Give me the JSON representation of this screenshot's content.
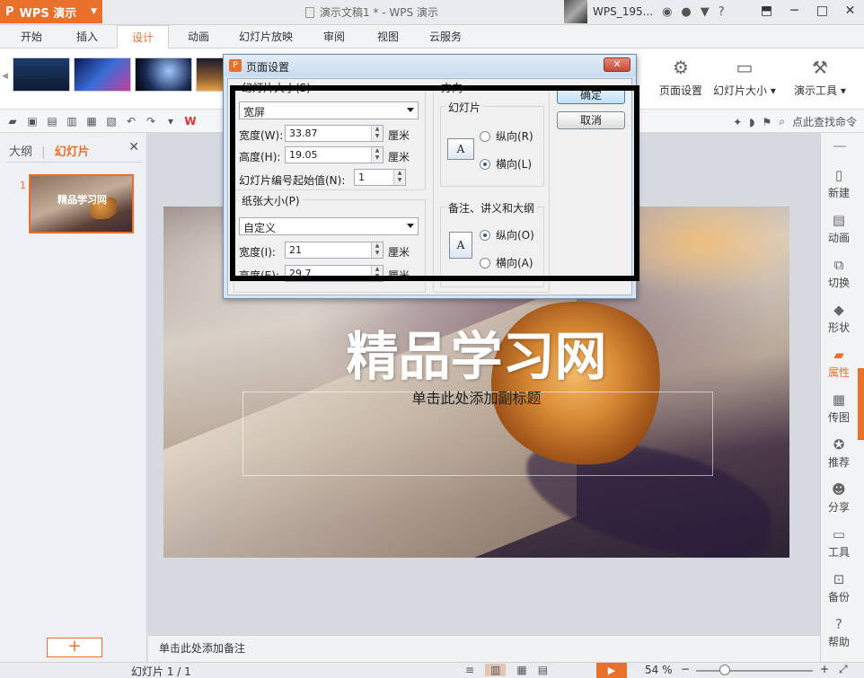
{
  "app": {
    "name": "WPS 演示",
    "logo": "P",
    "doc_title": "演示文稿1 * - WPS 演示",
    "user_name": "WPS_195..."
  },
  "tabs": [
    {
      "label": "开始"
    },
    {
      "label": "插入"
    },
    {
      "label": "设计"
    },
    {
      "label": "动画"
    },
    {
      "label": "幻灯片放映"
    },
    {
      "label": "审阅"
    },
    {
      "label": "视图"
    },
    {
      "label": "云服务"
    }
  ],
  "ribbon": {
    "page_setup": "页面设置",
    "slide_size": "幻灯片大小",
    "presenter_tools": "演示工具"
  },
  "quick_access": {
    "find_command": "点此查找命令"
  },
  "left_panel": {
    "outline_tab": "大纲",
    "slides_tab": "幻灯片",
    "separator": "|",
    "slide_number": "1",
    "thumb_title": "精品学习网",
    "add_slide": "+"
  },
  "slide": {
    "title": "精品学习网",
    "subtitle_placeholder": "单击此处添加副标题"
  },
  "notes_placeholder": "单击此处添加备注",
  "right_toolbar": [
    {
      "label": "新建",
      "icon": "new-file-icon"
    },
    {
      "label": "动画",
      "icon": "animation-icon"
    },
    {
      "label": "切换",
      "icon": "transition-icon"
    },
    {
      "label": "形状",
      "icon": "shape-icon"
    },
    {
      "label": "属性",
      "icon": "properties-icon"
    },
    {
      "label": "传图",
      "icon": "upload-image-icon"
    },
    {
      "label": "推荐",
      "icon": "recommend-icon"
    },
    {
      "label": "分享",
      "icon": "share-icon"
    },
    {
      "label": "工具",
      "icon": "toolbox-icon"
    },
    {
      "label": "备份",
      "icon": "backup-icon"
    },
    {
      "label": "帮助",
      "icon": "help-icon"
    }
  ],
  "statusbar": {
    "slide_indicator": "幻灯片 1 / 1",
    "zoom": "54 %",
    "zoom_level": 0.54
  },
  "dialog": {
    "title": "页面设置",
    "slide_size_label": "幻灯片大小(S)",
    "slide_size_value": "宽屏",
    "width_label": "宽度(W):",
    "width_value": "33.87",
    "height_label": "高度(H):",
    "height_value": "19.05",
    "unit": "厘米",
    "start_number_label": "幻灯片编号起始值(N):",
    "start_number_value": "1",
    "paper_size_label": "纸张大小(P)",
    "paper_size_value": "自定义",
    "paper_width_label": "宽度(I):",
    "paper_width_value": "21",
    "paper_height_label": "高度(E):",
    "paper_height_value": "29.7",
    "orientation_label": "方向",
    "slides_group": "幻灯片",
    "portrait_r": "纵向(R)",
    "landscape_l": "横向(L)",
    "notes_group": "备注、讲义和大纲",
    "portrait_o": "纵向(O)",
    "landscape_a": "横向(A)",
    "ok": "确定",
    "cancel": "取消"
  },
  "colors": {
    "accent": "#e8702a",
    "annotation_frame": "#000000"
  }
}
